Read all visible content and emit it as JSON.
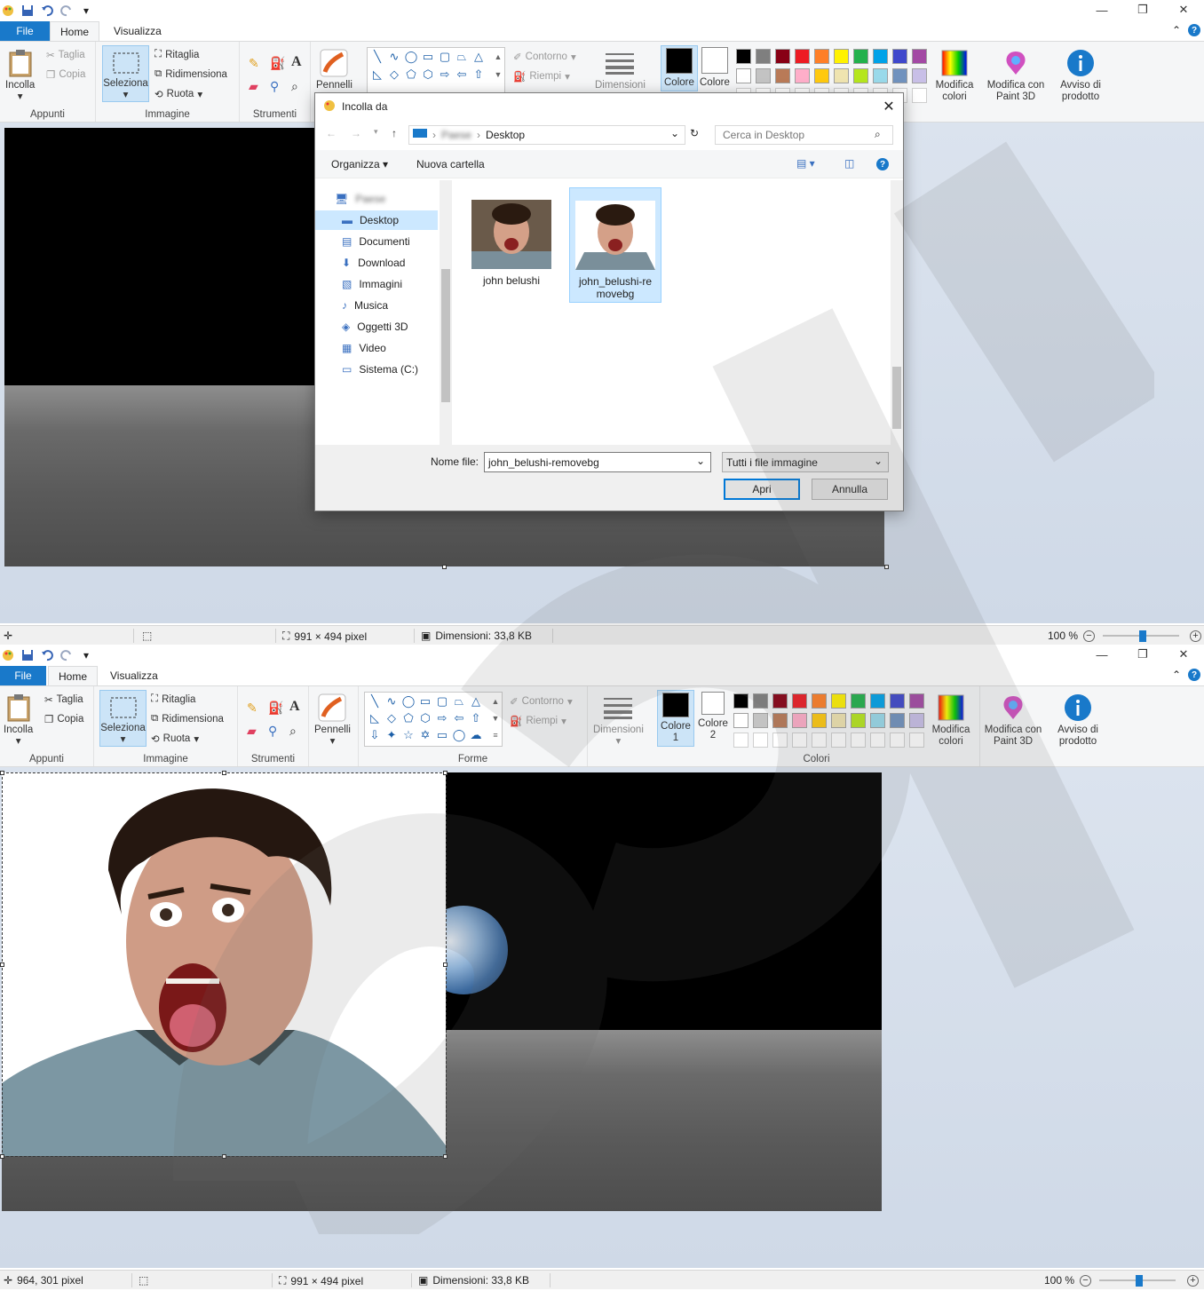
{
  "window1": {
    "tabs": {
      "file": "File",
      "home": "Home",
      "view": "Visualizza"
    },
    "ribbon": {
      "clipboard": {
        "paste": "Incolla",
        "cut": "Taglia",
        "copy": "Copia",
        "label": "Appunti"
      },
      "image": {
        "select": "Seleziona",
        "crop": "Ritaglia",
        "resize": "Ridimensiona",
        "rotate": "Ruota",
        "label": "Immagine"
      },
      "tools": {
        "label": "Strumenti"
      },
      "brushes": "Pennelli",
      "outline": "Contorno",
      "fill": "Riempi",
      "size": "Dimensioni",
      "color1": "Colore",
      "color2": "Colore",
      "edit_colors": "Modifica colori",
      "paint3d": "Modifica con Paint 3D",
      "product_alert": "Avviso di prodotto"
    },
    "status": {
      "position": "",
      "canvas_size": "991 × 494 pixel",
      "file_size": "Dimensioni: 33,8 KB",
      "zoom": "100 %"
    }
  },
  "dialog": {
    "title": "Incolla da",
    "address": {
      "parent": "Paese",
      "current": "Desktop"
    },
    "search_placeholder": "Cerca in Desktop",
    "organize": "Organizza",
    "new_folder": "Nuova cartella",
    "nav": [
      {
        "label": "Paese",
        "icon": "computer-icon"
      },
      {
        "label": "Desktop",
        "icon": "desktop-icon",
        "selected": true
      },
      {
        "label": "Documenti",
        "icon": "documents-icon"
      },
      {
        "label": "Download",
        "icon": "download-icon"
      },
      {
        "label": "Immagini",
        "icon": "pictures-icon"
      },
      {
        "label": "Musica",
        "icon": "music-icon"
      },
      {
        "label": "Oggetti 3D",
        "icon": "objects3d-icon"
      },
      {
        "label": "Video",
        "icon": "video-icon"
      },
      {
        "label": "Sistema (C:)",
        "icon": "drive-icon"
      }
    ],
    "files": [
      {
        "name": "john belushi"
      },
      {
        "name": "john_belushi-re movebg",
        "selected": true
      }
    ],
    "filename_label": "Nome file:",
    "filename_value": "john_belushi-removebg",
    "filetype": "Tutti i file immagine",
    "open": "Apri",
    "cancel": "Annulla"
  },
  "window2": {
    "tabs": {
      "file": "File",
      "home": "Home",
      "view": "Visualizza"
    },
    "ribbon": {
      "clipboard": {
        "paste": "Incolla",
        "cut": "Taglia",
        "copy": "Copia",
        "label": "Appunti"
      },
      "image": {
        "select": "Seleziona",
        "crop": "Ritaglia",
        "resize": "Ridimensiona",
        "rotate": "Ruota",
        "label": "Immagine"
      },
      "tools": {
        "label": "Strumenti"
      },
      "brushes": "Pennelli",
      "shapes_label": "Forme",
      "outline": "Contorno",
      "fill": "Riempi",
      "size": "Dimensioni",
      "color1": "Colore 1",
      "color2": "Colore 2",
      "edit_colors": "Modifica colori",
      "colors_label": "Colori",
      "paint3d": "Modifica con Paint 3D",
      "product_alert": "Avviso di prodotto"
    },
    "status": {
      "position": "964, 301 pixel",
      "canvas_size": "991 × 494 pixel",
      "file_size": "Dimensioni: 33,8 KB",
      "zoom": "100 %"
    }
  },
  "palette": [
    "#000000",
    "#7f7f7f",
    "#880015",
    "#ed1c24",
    "#ff7f27",
    "#fff200",
    "#22b14c",
    "#00a2e8",
    "#3f48cc",
    "#a349a4",
    "#ffffff",
    "#c3c3c3",
    "#b97a57",
    "#ffaec9",
    "#ffc90e",
    "#efe4b0",
    "#b5e61d",
    "#99d9ea",
    "#7092be",
    "#c8bfe7"
  ],
  "colors": {
    "accent": "#1979ca",
    "ribbon_bg": "#f5f6f7",
    "canvas_bg": "#d5deea"
  }
}
